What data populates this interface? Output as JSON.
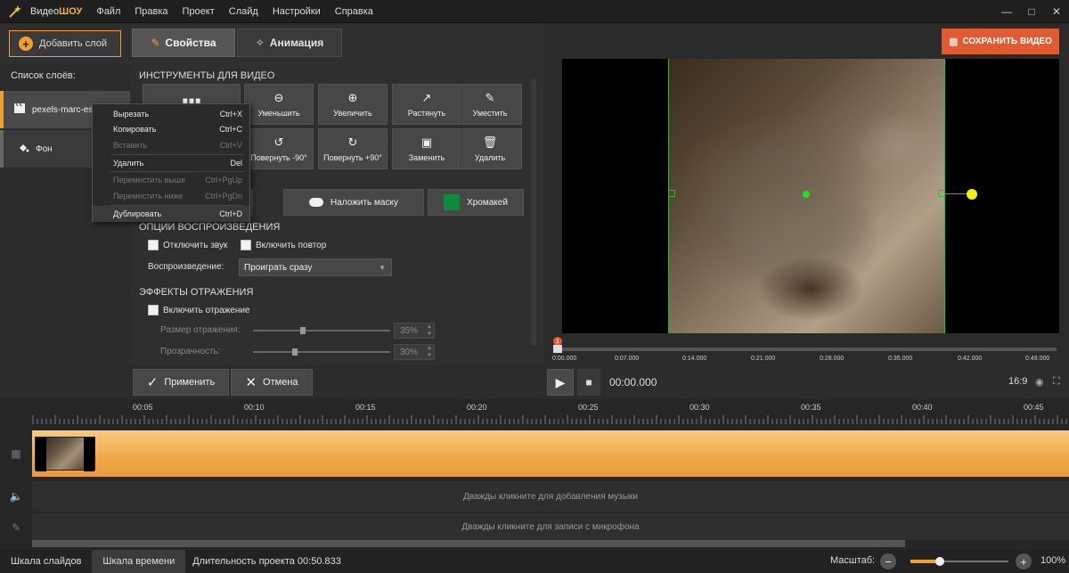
{
  "titlebar": {
    "app_name_prefix": "Видео",
    "app_name_suffix": "ШОУ",
    "menu": [
      "Файл",
      "Правка",
      "Проект",
      "Слайд",
      "Настройки",
      "Справка"
    ]
  },
  "toolbar": {
    "add_layer": "Добавить слой",
    "tab_properties": "Свойства",
    "tab_animation": "Анимация",
    "save_video": "СОХРАНИТЬ ВИДЕО"
  },
  "layers": {
    "title": "Список слоёв:",
    "items": [
      {
        "label": "pexels-marc-es",
        "icon": "clapperboard-icon"
      },
      {
        "label": "Фон",
        "icon": "paint-bucket-icon"
      }
    ]
  },
  "video_tools": {
    "title": "ИНСТРУМЕНТЫ ДЛЯ ВИДЕО",
    "row1": [
      "Уменьшить",
      "Увеличить",
      "Растянуть",
      "Уместить"
    ],
    "row2": [
      "Повернуть -90°",
      "Повернуть +90°",
      "Заменить",
      "Удалить"
    ],
    "mask": "Наложить маску",
    "chroma": "Хромакей"
  },
  "playback": {
    "title": "ОПЦИИ ВОСПРОИЗВЕДЕНИЯ",
    "mute": "Отключить звук",
    "loop": "Включить повтор",
    "play_label": "Воспроизведение:",
    "play_value": "Проиграть сразу"
  },
  "reflection": {
    "title": "ЭФФЕКТЫ ОТРАЖЕНИЯ",
    "enable": "Включить отражение",
    "size_label": "Размер отражения:",
    "size_value": "35%",
    "opacity_label": "Прозрачность:",
    "opacity_value": "30%"
  },
  "context_menu": [
    {
      "label": "Вырезать",
      "shortcut": "Ctrl+X",
      "disabled": false
    },
    {
      "label": "Копировать",
      "shortcut": "Ctrl+C",
      "disabled": false
    },
    {
      "label": "Вставить",
      "shortcut": "Ctrl+V",
      "disabled": true
    },
    {
      "label": "Удалить",
      "shortcut": "Del",
      "disabled": false
    },
    {
      "label": "Переместить выше",
      "shortcut": "Ctrl+PgUp",
      "disabled": true
    },
    {
      "label": "Переместить ниже",
      "shortcut": "Ctrl+PgDn",
      "disabled": true
    },
    {
      "label": "Дублировать",
      "shortcut": "Ctrl+D",
      "disabled": false
    }
  ],
  "preview_timeline": {
    "marker_number": "1",
    "times": [
      "0:00.000",
      "0:07.000",
      "0:14.000",
      "0:21.000",
      "0:28.000",
      "0:35.000",
      "0:42.000",
      "0:49.000"
    ]
  },
  "actions": {
    "apply": "Применить",
    "cancel": "Отмена"
  },
  "player": {
    "timecode": "00:00.000",
    "aspect": "16:9"
  },
  "timeline": {
    "ruler": [
      "00:05",
      "00:10",
      "00:15",
      "00:20",
      "00:25",
      "00:30",
      "00:35",
      "00:40",
      "00:45"
    ],
    "music_hint": "Дважды кликните для добавления музыки",
    "mic_hint": "Дважды кликните для записи с микрофона"
  },
  "statusbar": {
    "slides_tab": "Шкала слайдов",
    "timeline_tab": "Шкала времени",
    "duration": "Длительность проекта 00:50.833",
    "zoom_label": "Масштаб:",
    "zoom_value": "100%",
    "zoom_level": 0.3
  },
  "colors": {
    "accent": "#f0a030",
    "save": "#e05a32",
    "guide": "#1ec31e"
  }
}
